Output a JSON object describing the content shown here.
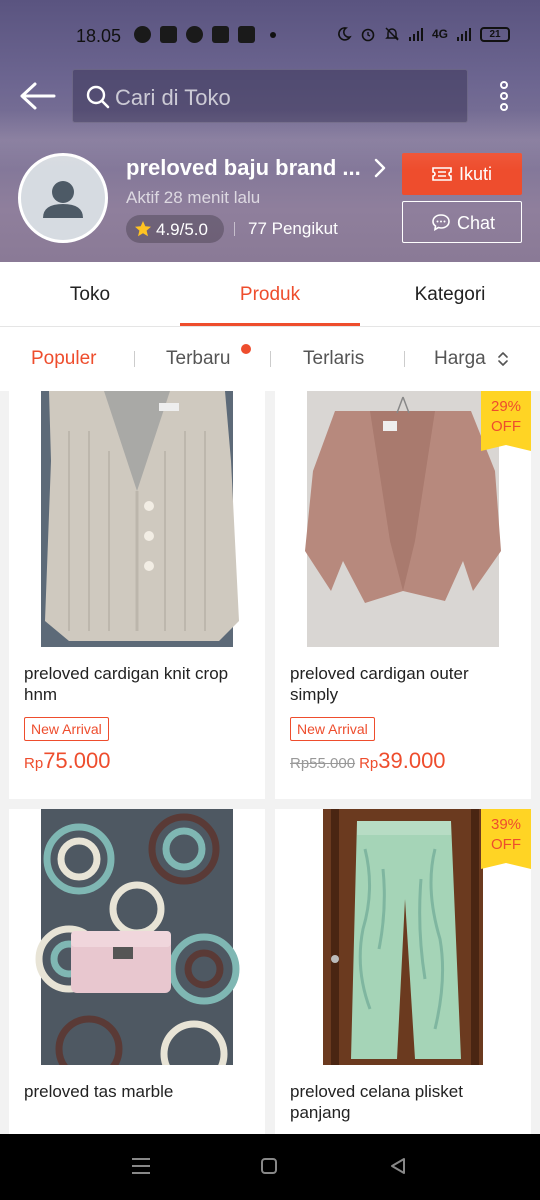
{
  "status_bar": {
    "time": "18.05",
    "network": "4G",
    "battery": "21"
  },
  "header": {
    "search_placeholder": "Cari di Toko",
    "shop_name": "preloved baju brand ...",
    "active_status": "Aktif 28 menit lalu",
    "rating": "4.9/5.0",
    "followers": "77 Pengikut",
    "follow_label": "Ikuti",
    "chat_label": "Chat"
  },
  "tabs": [
    {
      "label": "Toko"
    },
    {
      "label": "Produk"
    },
    {
      "label": "Kategori"
    }
  ],
  "sort": [
    {
      "label": "Populer"
    },
    {
      "label": "Terbaru"
    },
    {
      "label": "Terlaris"
    },
    {
      "label": "Harga"
    }
  ],
  "products": [
    {
      "name": "preloved cardigan knit crop hnm",
      "badge": "New Arrival",
      "currency": "Rp",
      "price": "75.000"
    },
    {
      "name": "preloved cardigan outer simply",
      "badge": "New Arrival",
      "old_price": "Rp55.000",
      "currency": "Rp",
      "price": "39.000",
      "discount_pct": "29%",
      "discount_off": "OFF"
    },
    {
      "name": "preloved tas marble"
    },
    {
      "name": "preloved celana plisket panjang",
      "discount_pct": "39%",
      "discount_off": "OFF"
    }
  ],
  "colors": {
    "accent": "#ee4d2d",
    "discount_bg": "#ffd424"
  }
}
